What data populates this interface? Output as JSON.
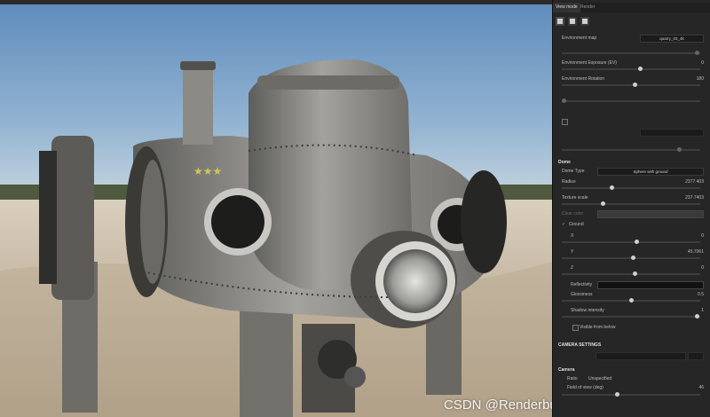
{
  "panel": {
    "tabs": [
      {
        "label": "View mode"
      },
      {
        "label": "Render"
      }
    ],
    "environment": {
      "environment_map_label": "Environment map",
      "environment_map_value": "quarry_03_4k",
      "environment_exposure_label": "Environment Exposure (EV)",
      "environment_exposure_value": "0",
      "environment_rotation_label": "Environment Rotation",
      "environment_rotation_value": "180"
    },
    "dome": {
      "header": "Dome",
      "dome_type_label": "Dome Type",
      "dome_type_value": "Sphere with ground",
      "radius_label": "Radius",
      "radius_value": "2377.403",
      "texture_scale_label": "Texture scale",
      "texture_scale_value": "237.7403",
      "clear_color_label": "Clear color",
      "ground_label": "Ground",
      "x_label": "X",
      "x_value": "0",
      "y_label": "Y",
      "y_value": "45.7061",
      "z_label": "Z",
      "z_value": "0",
      "reflectivity_label": "Reflectivity",
      "glossiness_label": "Glossiness",
      "glossiness_value": "0.5",
      "shadow_intensity_label": "Shadow intensity",
      "shadow_intensity_value": "1",
      "visible_from_below_label": "Visible from below"
    },
    "camera_settings": {
      "header": "CAMERA SETTINGS",
      "camera_label": "Camera",
      "ratio_label": "Ratio",
      "ratio_value": "Unspecified",
      "field_of_view_label": "Field of view (deg)",
      "field_of_view_value": "46"
    }
  },
  "viewport": {
    "watermark": "CSDN @Renderbus瑞云渲染农场"
  },
  "colors": {
    "panel_bg": "#262626",
    "sky_top": "#6f99c4",
    "sand": "#c7b9a0",
    "metal": "#8f8f8c"
  }
}
